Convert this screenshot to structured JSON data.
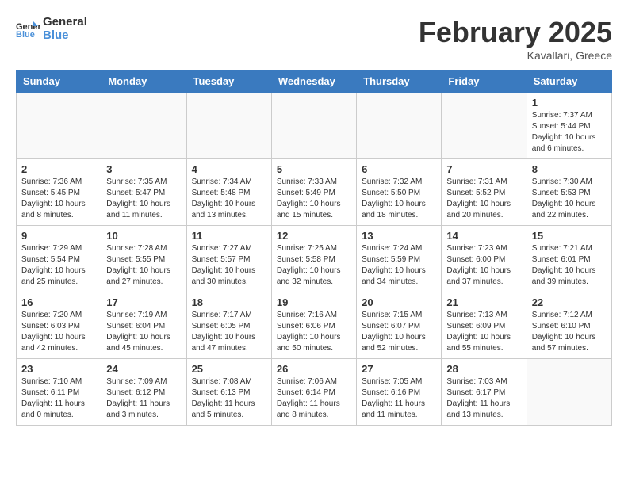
{
  "header": {
    "logo_line1": "General",
    "logo_line2": "Blue",
    "month_title": "February 2025",
    "location": "Kavallari, Greece"
  },
  "weekdays": [
    "Sunday",
    "Monday",
    "Tuesday",
    "Wednesday",
    "Thursday",
    "Friday",
    "Saturday"
  ],
  "weeks": [
    [
      {
        "day": "",
        "info": ""
      },
      {
        "day": "",
        "info": ""
      },
      {
        "day": "",
        "info": ""
      },
      {
        "day": "",
        "info": ""
      },
      {
        "day": "",
        "info": ""
      },
      {
        "day": "",
        "info": ""
      },
      {
        "day": "1",
        "info": "Sunrise: 7:37 AM\nSunset: 5:44 PM\nDaylight: 10 hours\nand 6 minutes."
      }
    ],
    [
      {
        "day": "2",
        "info": "Sunrise: 7:36 AM\nSunset: 5:45 PM\nDaylight: 10 hours\nand 8 minutes."
      },
      {
        "day": "3",
        "info": "Sunrise: 7:35 AM\nSunset: 5:47 PM\nDaylight: 10 hours\nand 11 minutes."
      },
      {
        "day": "4",
        "info": "Sunrise: 7:34 AM\nSunset: 5:48 PM\nDaylight: 10 hours\nand 13 minutes."
      },
      {
        "day": "5",
        "info": "Sunrise: 7:33 AM\nSunset: 5:49 PM\nDaylight: 10 hours\nand 15 minutes."
      },
      {
        "day": "6",
        "info": "Sunrise: 7:32 AM\nSunset: 5:50 PM\nDaylight: 10 hours\nand 18 minutes."
      },
      {
        "day": "7",
        "info": "Sunrise: 7:31 AM\nSunset: 5:52 PM\nDaylight: 10 hours\nand 20 minutes."
      },
      {
        "day": "8",
        "info": "Sunrise: 7:30 AM\nSunset: 5:53 PM\nDaylight: 10 hours\nand 22 minutes."
      }
    ],
    [
      {
        "day": "9",
        "info": "Sunrise: 7:29 AM\nSunset: 5:54 PM\nDaylight: 10 hours\nand 25 minutes."
      },
      {
        "day": "10",
        "info": "Sunrise: 7:28 AM\nSunset: 5:55 PM\nDaylight: 10 hours\nand 27 minutes."
      },
      {
        "day": "11",
        "info": "Sunrise: 7:27 AM\nSunset: 5:57 PM\nDaylight: 10 hours\nand 30 minutes."
      },
      {
        "day": "12",
        "info": "Sunrise: 7:25 AM\nSunset: 5:58 PM\nDaylight: 10 hours\nand 32 minutes."
      },
      {
        "day": "13",
        "info": "Sunrise: 7:24 AM\nSunset: 5:59 PM\nDaylight: 10 hours\nand 34 minutes."
      },
      {
        "day": "14",
        "info": "Sunrise: 7:23 AM\nSunset: 6:00 PM\nDaylight: 10 hours\nand 37 minutes."
      },
      {
        "day": "15",
        "info": "Sunrise: 7:21 AM\nSunset: 6:01 PM\nDaylight: 10 hours\nand 39 minutes."
      }
    ],
    [
      {
        "day": "16",
        "info": "Sunrise: 7:20 AM\nSunset: 6:03 PM\nDaylight: 10 hours\nand 42 minutes."
      },
      {
        "day": "17",
        "info": "Sunrise: 7:19 AM\nSunset: 6:04 PM\nDaylight: 10 hours\nand 45 minutes."
      },
      {
        "day": "18",
        "info": "Sunrise: 7:17 AM\nSunset: 6:05 PM\nDaylight: 10 hours\nand 47 minutes."
      },
      {
        "day": "19",
        "info": "Sunrise: 7:16 AM\nSunset: 6:06 PM\nDaylight: 10 hours\nand 50 minutes."
      },
      {
        "day": "20",
        "info": "Sunrise: 7:15 AM\nSunset: 6:07 PM\nDaylight: 10 hours\nand 52 minutes."
      },
      {
        "day": "21",
        "info": "Sunrise: 7:13 AM\nSunset: 6:09 PM\nDaylight: 10 hours\nand 55 minutes."
      },
      {
        "day": "22",
        "info": "Sunrise: 7:12 AM\nSunset: 6:10 PM\nDaylight: 10 hours\nand 57 minutes."
      }
    ],
    [
      {
        "day": "23",
        "info": "Sunrise: 7:10 AM\nSunset: 6:11 PM\nDaylight: 11 hours\nand 0 minutes."
      },
      {
        "day": "24",
        "info": "Sunrise: 7:09 AM\nSunset: 6:12 PM\nDaylight: 11 hours\nand 3 minutes."
      },
      {
        "day": "25",
        "info": "Sunrise: 7:08 AM\nSunset: 6:13 PM\nDaylight: 11 hours\nand 5 minutes."
      },
      {
        "day": "26",
        "info": "Sunrise: 7:06 AM\nSunset: 6:14 PM\nDaylight: 11 hours\nand 8 minutes."
      },
      {
        "day": "27",
        "info": "Sunrise: 7:05 AM\nSunset: 6:16 PM\nDaylight: 11 hours\nand 11 minutes."
      },
      {
        "day": "28",
        "info": "Sunrise: 7:03 AM\nSunset: 6:17 PM\nDaylight: 11 hours\nand 13 minutes."
      },
      {
        "day": "",
        "info": ""
      }
    ]
  ]
}
